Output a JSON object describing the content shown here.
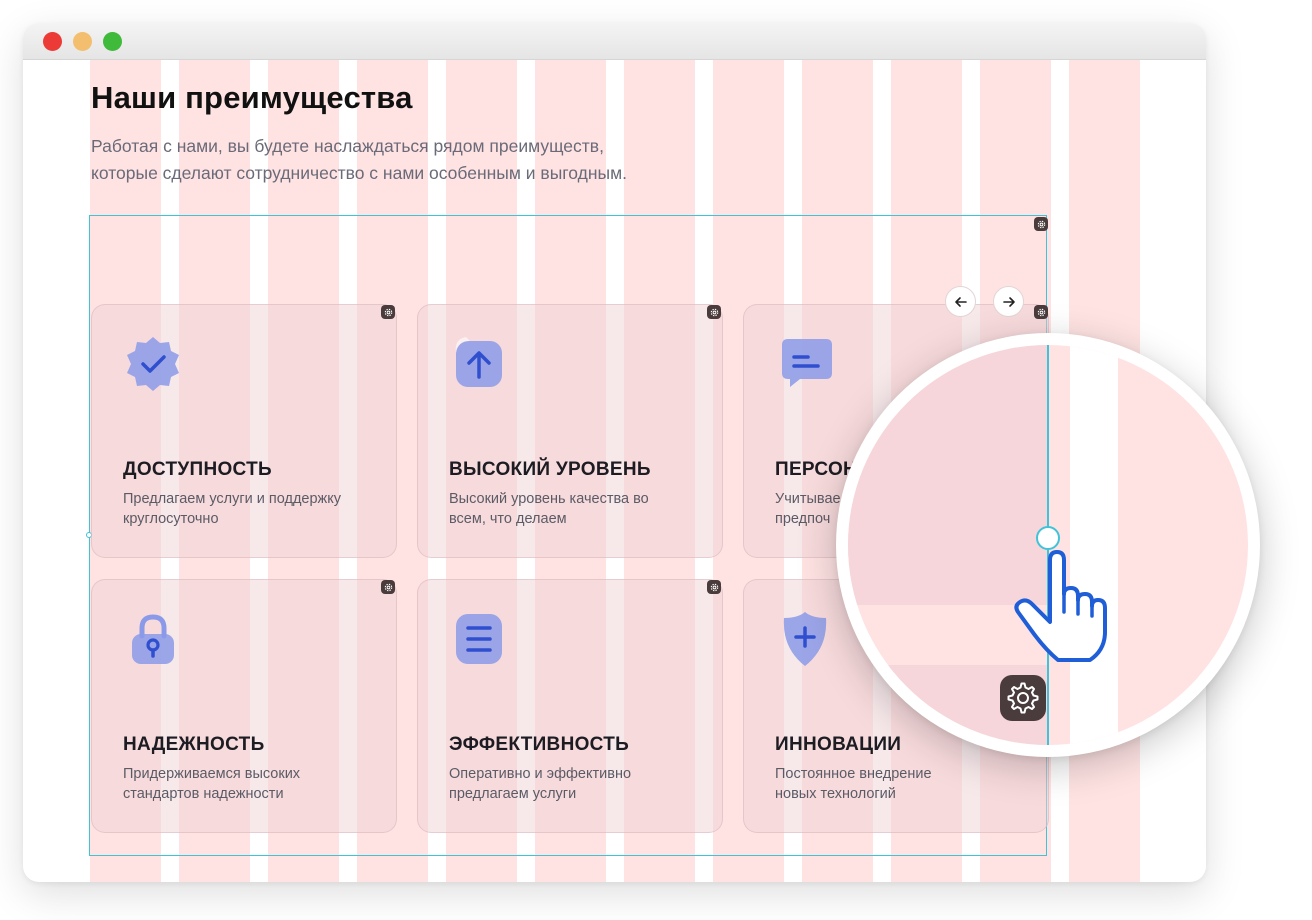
{
  "page": {
    "title": "Наши преимущества",
    "subtitle_line1": "Работая с нами, вы будете наслаждаться рядом преимуществ,",
    "subtitle_line2": "которые сделают сотрудничество с нами особенным и выгодным."
  },
  "carousel": {
    "prev_icon": "arrow-left-icon",
    "next_icon": "arrow-right-icon"
  },
  "cards": [
    {
      "title": "ДОСТУПНОСТЬ",
      "desc_line1": "Предлагаем услуги и поддержку",
      "desc_line2": "круглосуточно",
      "icon": "verified-badge-icon"
    },
    {
      "title": "ВЫСОКИЙ УРОВЕНЬ",
      "desc_line1": "Высокий уровень качества во",
      "desc_line2": "всем, что делаем",
      "icon": "upload-arrow-icon"
    },
    {
      "title": "ПЕРСОН",
      "desc_line1": "Учитывае",
      "desc_line2": "предпоч",
      "icon": "chat-bubble-icon"
    },
    {
      "title": "НАДЕЖНОСТЬ",
      "desc_line1": "Придерживаемся высоких",
      "desc_line2": "стандартов надежности",
      "icon": "padlock-icon"
    },
    {
      "title": "ЭФФЕКТИВНОСТЬ",
      "desc_line1": "Оперативно и эффективно",
      "desc_line2": "предлагаем услуги",
      "icon": "document-lines-icon"
    },
    {
      "title": "ИННОВАЦИИ",
      "desc_line1": "Постоянное внедрение",
      "desc_line2": "новых технологий",
      "icon": "shield-plus-icon"
    }
  ],
  "colors": {
    "grid_column": "#ffe3e3",
    "selection": "#3fc3d8",
    "icon_blue": "#3d5fd8",
    "close": "#ec3a37",
    "minimize": "#f3bf6e",
    "maximize": "#3fba3a"
  }
}
